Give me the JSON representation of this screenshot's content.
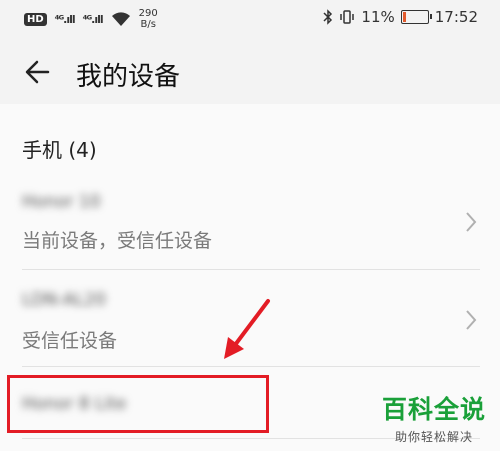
{
  "status_bar": {
    "hd": "HD",
    "sig1": "⁴ᴳ.ıll",
    "sig2": "⁴ᴳ.ıll",
    "speed_value": "290",
    "speed_unit": "B/s",
    "battery_percent": "11%",
    "time": "17:52"
  },
  "header": {
    "title": "我的设备"
  },
  "section": {
    "title": "手机 (4)"
  },
  "devices": [
    {
      "name": "Honor 10",
      "subtitle": "当前设备，受信任设备"
    },
    {
      "name": "LDN-AL20",
      "subtitle": "受信任设备"
    },
    {
      "name": "Honor 8 Lite",
      "subtitle": ""
    }
  ],
  "watermark": {
    "main": "百科全说",
    "sub": "助你轻松解决"
  }
}
